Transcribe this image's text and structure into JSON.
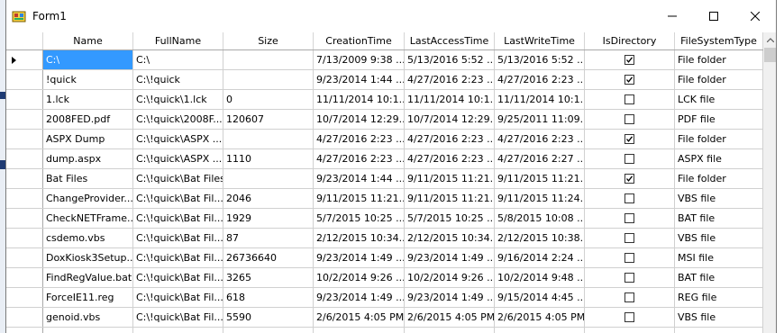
{
  "window": {
    "title": "Form1"
  },
  "caption_buttons": {
    "minimize": "minimize",
    "maximize": "maximize",
    "close": "close"
  },
  "grid": {
    "columns": [
      {
        "key": "rowhead",
        "label": ""
      },
      {
        "key": "name",
        "label": "Name"
      },
      {
        "key": "fullname",
        "label": "FullName"
      },
      {
        "key": "size",
        "label": "Size"
      },
      {
        "key": "creation",
        "label": "CreationTime"
      },
      {
        "key": "access",
        "label": "LastAccessTime"
      },
      {
        "key": "write",
        "label": "LastWriteTime"
      },
      {
        "key": "isdir",
        "label": "IsDirectory"
      },
      {
        "key": "fstype",
        "label": "FileSystemType"
      }
    ],
    "selected_row": 0,
    "rows": [
      {
        "name": "C:\\",
        "fullname": "C:\\",
        "size": "",
        "creation": "7/13/2009 9:38 ...",
        "access": "5/13/2016 5:52 ...",
        "write": "5/13/2016 5:52 ...",
        "isdir": true,
        "fstype": "File folder"
      },
      {
        "name": "!quick",
        "fullname": "C:\\!quick",
        "size": "",
        "creation": "9/23/2014 1:44 ...",
        "access": "4/27/2016 2:23 ...",
        "write": "4/27/2016 2:23 ...",
        "isdir": true,
        "fstype": "File folder"
      },
      {
        "name": "1.lck",
        "fullname": "C:\\!quick\\1.lck",
        "size": "0",
        "creation": "11/11/2014 10:1...",
        "access": "11/11/2014 10:1...",
        "write": "11/11/2014 10:1...",
        "isdir": false,
        "fstype": "LCK file"
      },
      {
        "name": "2008FED.pdf",
        "fullname": "C:\\!quick\\2008F...",
        "size": "120607",
        "creation": "10/7/2014 12:29...",
        "access": "10/7/2014 12:29...",
        "write": "9/25/2011 11:09...",
        "isdir": false,
        "fstype": "PDF file"
      },
      {
        "name": "ASPX Dump",
        "fullname": "C:\\!quick\\ASPX ...",
        "size": "",
        "creation": "4/27/2016 2:23 ...",
        "access": "4/27/2016 2:23 ...",
        "write": "4/27/2016 2:23 ...",
        "isdir": true,
        "fstype": "File folder"
      },
      {
        "name": "dump.aspx",
        "fullname": "C:\\!quick\\ASPX ...",
        "size": "1110",
        "creation": "4/27/2016 2:23 ...",
        "access": "4/27/2016 2:23 ...",
        "write": "4/27/2016 2:27 ...",
        "isdir": false,
        "fstype": "ASPX file"
      },
      {
        "name": "Bat Files",
        "fullname": "C:\\!quick\\Bat Files",
        "size": "",
        "creation": "9/23/2014 1:44 ...",
        "access": "9/11/2015 11:21...",
        "write": "9/11/2015 11:21...",
        "isdir": true,
        "fstype": "File folder"
      },
      {
        "name": "ChangeProvider....",
        "fullname": "C:\\!quick\\Bat Fil...",
        "size": "2046",
        "creation": "9/11/2015 11:21...",
        "access": "9/11/2015 11:21...",
        "write": "9/11/2015 11:24...",
        "isdir": false,
        "fstype": "VBS file"
      },
      {
        "name": "CheckNETFrame...",
        "fullname": "C:\\!quick\\Bat Fil...",
        "size": "1929",
        "creation": "5/7/2015 10:25 ...",
        "access": "5/7/2015 10:25 ...",
        "write": "5/8/2015 10:08 ...",
        "isdir": false,
        "fstype": "BAT file"
      },
      {
        "name": "csdemo.vbs",
        "fullname": "C:\\!quick\\Bat Fil...",
        "size": "87",
        "creation": "2/12/2015 10:34...",
        "access": "2/12/2015 10:34...",
        "write": "2/12/2015 10:38...",
        "isdir": false,
        "fstype": "VBS file"
      },
      {
        "name": "DoxKiosk3Setup....",
        "fullname": "C:\\!quick\\Bat Fil...",
        "size": "26736640",
        "creation": "9/23/2014 1:49 ...",
        "access": "9/23/2014 1:49 ...",
        "write": "9/16/2014 2:24 ...",
        "isdir": false,
        "fstype": "MSI file"
      },
      {
        "name": "FindRegValue.bat",
        "fullname": "C:\\!quick\\Bat Fil...",
        "size": "3265",
        "creation": "10/2/2014 9:26 ...",
        "access": "10/2/2014 9:26 ...",
        "write": "10/2/2014 9:48 ...",
        "isdir": false,
        "fstype": "BAT file"
      },
      {
        "name": "ForceIE11.reg",
        "fullname": "C:\\!quick\\Bat Fil...",
        "size": "618",
        "creation": "9/23/2014 1:49 ...",
        "access": "9/23/2014 1:49 ...",
        "write": "9/15/2014 4:45 ...",
        "isdir": false,
        "fstype": "REG file"
      },
      {
        "name": "genoid.vbs",
        "fullname": "C:\\!quick\\Bat Fil...",
        "size": "5590",
        "creation": "2/6/2015 4:05 PM",
        "access": "2/6/2015 4:05 PM",
        "write": "2/6/2015 4:05 PM",
        "isdir": false,
        "fstype": "VBS file"
      },
      {
        "name": "",
        "fullname": "",
        "size": "",
        "creation": "",
        "access": "",
        "write": "",
        "isdir": false,
        "fstype": ""
      }
    ]
  }
}
